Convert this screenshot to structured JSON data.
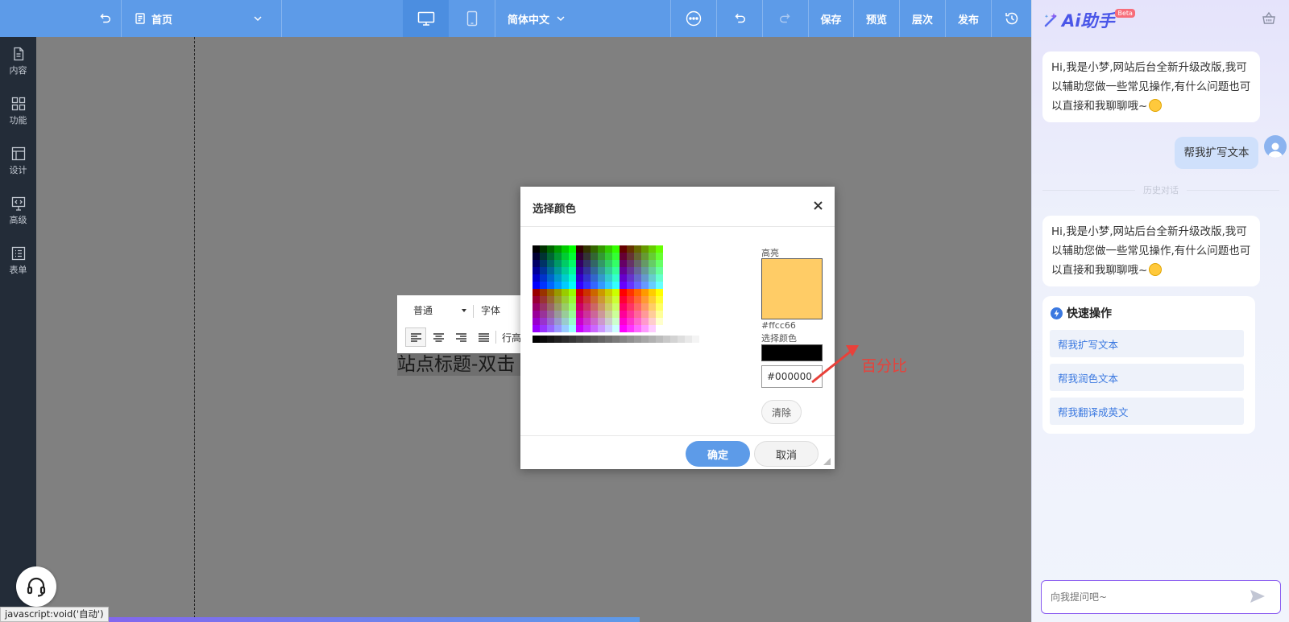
{
  "topbar": {
    "page_select": "首页",
    "language": "简体中文",
    "save": "保存",
    "preview": "预览",
    "layers": "层次",
    "publish": "发布"
  },
  "leftbar": {
    "items": [
      {
        "label": "内容",
        "icon": "file-icon"
      },
      {
        "label": "功能",
        "icon": "grid-icon"
      },
      {
        "label": "设计",
        "icon": "layout-icon"
      },
      {
        "label": "高级",
        "icon": "code-monitor-icon"
      },
      {
        "label": "表单",
        "icon": "list-icon"
      }
    ]
  },
  "editor": {
    "format_select": "普通",
    "font_select": "字体",
    "line_height_fragment": "行高",
    "site_title_fragment": "站点标题-双击"
  },
  "color_dialog": {
    "title": "选择颜色",
    "highlight_label": "高亮",
    "highlight_value": "#ffcc66",
    "select_label": "选择颜色",
    "hex_input_value": "#000000",
    "clear": "清除",
    "confirm": "确定",
    "cancel": "取消",
    "highlight_color": "#ffcc66",
    "selected_color": "#000000"
  },
  "annotation": {
    "text": "百分比",
    "color": "#e8413a"
  },
  "assistant": {
    "title": "Ai助手",
    "badge": "Beta",
    "greeting": "Hi,我是小梦,网站后台全新升级改版,我可以辅助您做一些常见操作,有什么问题也可以直接和我聊聊哦~",
    "user_message": "帮我扩写文本",
    "history_divider": "历史对话",
    "greeting_2": "Hi,我是小梦,网站后台全新升级改版,我可以辅助您做一些常见操作,有什么问题也可以直接和我聊聊哦~",
    "quick_title": "快速操作",
    "quick_actions": [
      "帮我扩写文本",
      "帮我润色文本",
      "帮我翻译成英文"
    ],
    "input_placeholder": "向我提问吧~"
  },
  "status_bar": "javascript:void('自动')",
  "progress": 0.62
}
